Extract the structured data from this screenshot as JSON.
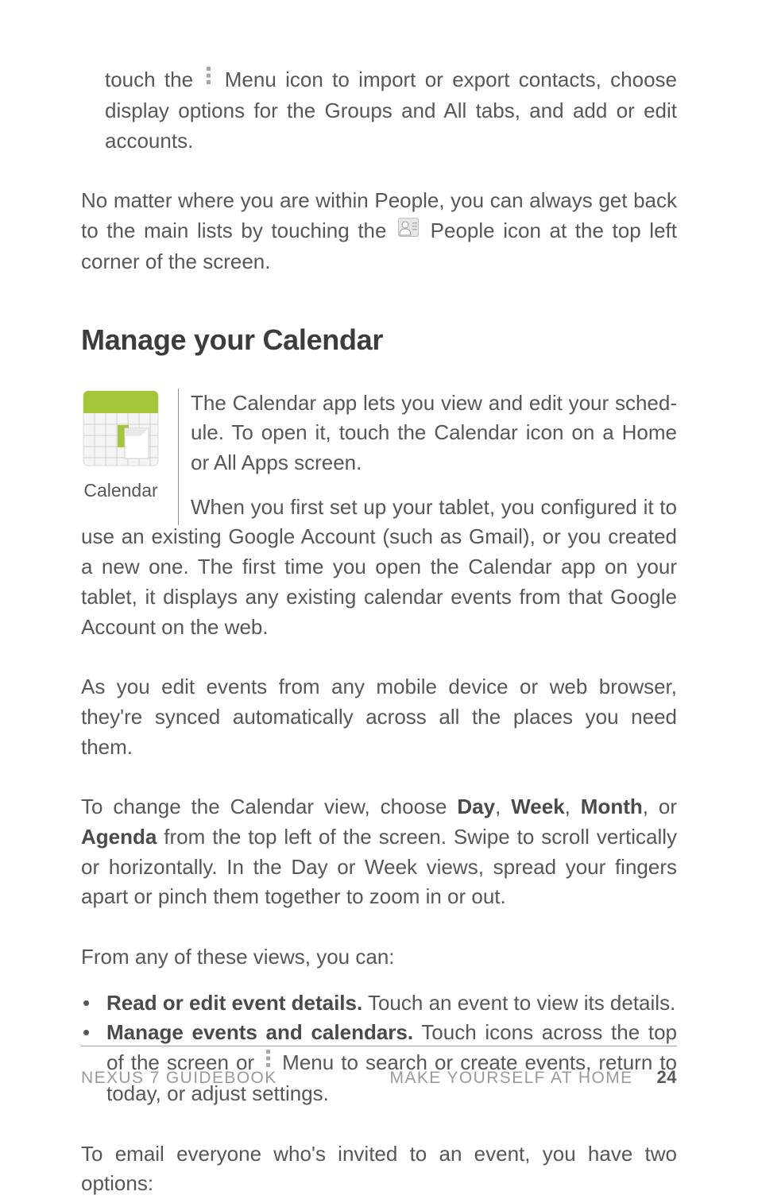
{
  "p1": {
    "pre": "touch the ",
    "post": " Menu icon to import or export contacts, choose display options for the Groups and All tabs, and add or edit accounts."
  },
  "p2": {
    "pre": "No matter where you are within People, you can always get back to the main lists by touching the ",
    "post": " People icon at the top left corner of the screen."
  },
  "heading": "Manage your Calendar",
  "calendar": {
    "caption": "Calendar"
  },
  "intro": "The Calendar app lets you view and edit your sched­ule. To open it, touch the Calendar icon on a Home or All Apps screen.",
  "flow": "When you first set up your tablet, you configured it to use an existing Google Account (such as Gmail), or you cre­ated a new one. The first time you open the Calendar app on your tablet, it displays any existing calendar events from that Google Account on the web.",
  "p3": "As you edit events from any mobile device or web browser, they're synced automatically across all the places you need them.",
  "p4": {
    "pre": "To change the Calendar view, choose ",
    "day": "Day",
    "c1": ", ",
    "week": "Week",
    "c2": ", ",
    "month": "Month",
    "c3": ", or ",
    "agenda": "Agen­da",
    "post": " from the top left of the screen. Swipe to scroll vertically or horizontally. In the Day or Week views, spread your fingers apart or pinch them together to zoom in or out."
  },
  "p5": "From any of these views, you can:",
  "b1": {
    "bold": "Read or edit event details.",
    "rest": " Touch an event to view its details."
  },
  "b2": {
    "bold": "Manage events and calendars.",
    "pre": " Touch icons across the top of the screen or ",
    "post": " Menu to search or create events, return to to­day, or adjust settings."
  },
  "p6": "To email everyone who's invited to an event, you have two options:",
  "footer": {
    "left": "NEXUS 7 GUIDEBOOK",
    "right": "MAKE YOURSELF AT HOME",
    "page": "24"
  }
}
